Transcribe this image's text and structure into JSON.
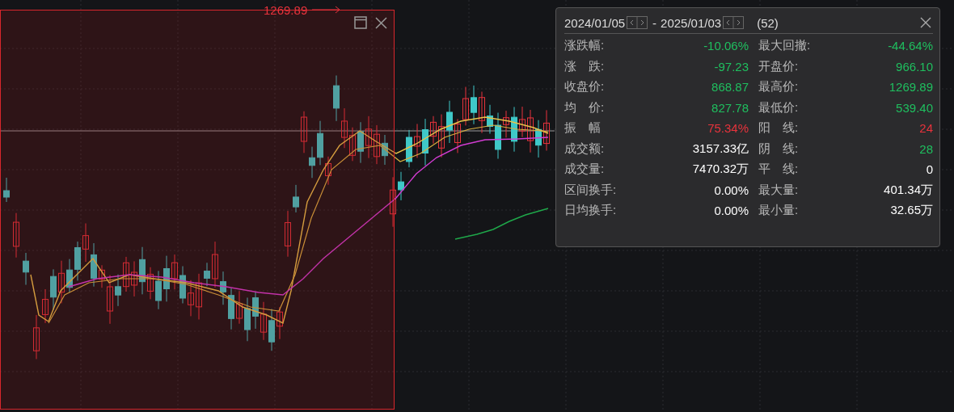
{
  "chart": {
    "high_marker": "1269.89"
  },
  "stats_panel": {
    "start_date": "2024/01/05",
    "separator": "-",
    "end_date": "2025/01/03",
    "count": "(52)",
    "left": [
      {
        "label": "涨跌幅:",
        "value": "-10.06%",
        "color": "#1fbf5f"
      },
      {
        "label": "涨　跌:",
        "value": "-97.23",
        "color": "#1fbf5f"
      },
      {
        "label": "收盘价:",
        "value": "868.87",
        "color": "#1fbf5f"
      },
      {
        "label": "均　价:",
        "value": "827.78",
        "color": "#1fbf5f"
      },
      {
        "label": "振　幅",
        "value": "75.34%",
        "color": "#e8333c"
      },
      {
        "label": "成交额:",
        "value": "3157.33亿",
        "color": "#ffffff"
      },
      {
        "label": "成交量:",
        "value": "7470.32万",
        "color": "#ffffff"
      },
      {
        "label": "区间换手:",
        "value": "0.00%",
        "color": "#ffffff"
      },
      {
        "label": "日均换手:",
        "value": "0.00%",
        "color": "#ffffff"
      }
    ],
    "right": [
      {
        "label": "最大回撤:",
        "value": "-44.64%",
        "color": "#1fbf5f"
      },
      {
        "label": "开盘价:",
        "value": "966.10",
        "color": "#1fbf5f"
      },
      {
        "label": "最高价:",
        "value": "1269.89",
        "color": "#1fbf5f"
      },
      {
        "label": "最低价:",
        "value": "539.40",
        "color": "#1fbf5f"
      },
      {
        "label": "阳　线:",
        "value": "24",
        "color": "#e8333c"
      },
      {
        "label": "阴　线:",
        "value": "28",
        "color": "#1fbf5f"
      },
      {
        "label": "平　线:",
        "value": "0",
        "color": "#ffffff"
      },
      {
        "label": "最大量:",
        "value": "401.34万",
        "color": "#ffffff"
      },
      {
        "label": "最小量:",
        "value": "32.65万",
        "color": "#ffffff"
      }
    ]
  }
}
